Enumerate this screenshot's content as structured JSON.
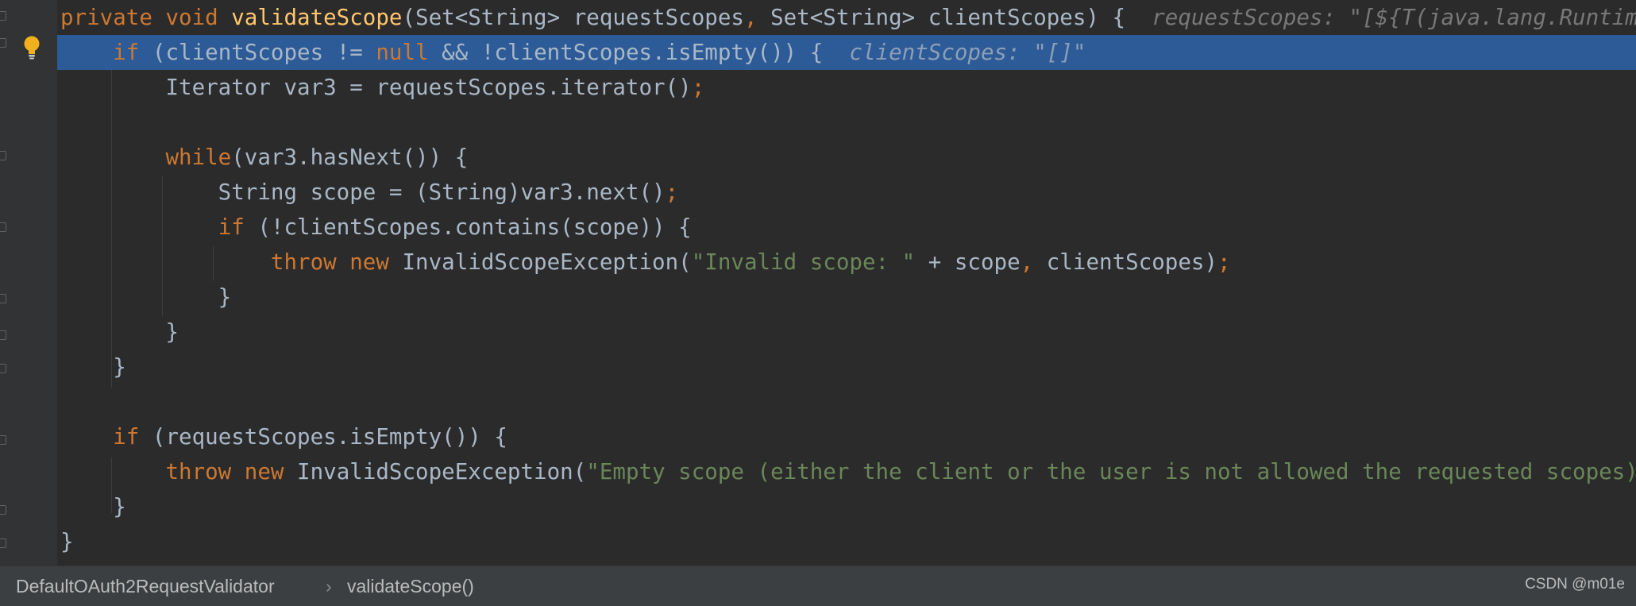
{
  "code_lines": [
    {
      "tokens": [
        {
          "t": "private void ",
          "c": "kw"
        },
        {
          "t": "validateScope",
          "c": "fn"
        },
        {
          "t": "(Set<String> requestScopes",
          "c": "plain"
        },
        {
          "t": ", ",
          "c": "kw"
        },
        {
          "t": "Set<String> clientScopes) {  ",
          "c": "plain"
        },
        {
          "t": "requestScopes: \"[${T(java.lang.Runtime).g",
          "c": "hint"
        }
      ]
    },
    {
      "tokens": [
        {
          "t": "    ",
          "c": "plain"
        },
        {
          "t": "if ",
          "c": "kw"
        },
        {
          "t": "(clientScopes != ",
          "c": "plain"
        },
        {
          "t": "null ",
          "c": "kw"
        },
        {
          "t": "&& !clientScopes.isEmpty()) {  ",
          "c": "plain"
        },
        {
          "t": "clientScopes: \"[]\"",
          "c": "hint"
        }
      ]
    },
    {
      "tokens": [
        {
          "t": "        Iterator var3 = requestScopes.iterator()",
          "c": "plain"
        },
        {
          "t": ";",
          "c": "kw"
        }
      ]
    },
    {
      "tokens": []
    },
    {
      "tokens": [
        {
          "t": "        ",
          "c": "plain"
        },
        {
          "t": "while",
          "c": "kw"
        },
        {
          "t": "(var3.hasNext()) {",
          "c": "plain"
        }
      ]
    },
    {
      "tokens": [
        {
          "t": "            String scope = (String)var3.next()",
          "c": "plain"
        },
        {
          "t": ";",
          "c": "kw"
        }
      ]
    },
    {
      "tokens": [
        {
          "t": "            ",
          "c": "plain"
        },
        {
          "t": "if ",
          "c": "kw"
        },
        {
          "t": "(!clientScopes.contains(scope)) {",
          "c": "plain"
        }
      ]
    },
    {
      "tokens": [
        {
          "t": "                ",
          "c": "plain"
        },
        {
          "t": "throw new ",
          "c": "kw"
        },
        {
          "t": "InvalidScopeException(",
          "c": "plain"
        },
        {
          "t": "\"Invalid scope: \" ",
          "c": "str"
        },
        {
          "t": "+ scope",
          "c": "plain"
        },
        {
          "t": ", ",
          "c": "kw"
        },
        {
          "t": "clientScopes)",
          "c": "plain"
        },
        {
          "t": ";",
          "c": "kw"
        }
      ]
    },
    {
      "tokens": [
        {
          "t": "            }",
          "c": "plain"
        }
      ]
    },
    {
      "tokens": [
        {
          "t": "        }",
          "c": "plain"
        }
      ]
    },
    {
      "tokens": [
        {
          "t": "    }",
          "c": "plain"
        }
      ]
    },
    {
      "tokens": []
    },
    {
      "tokens": [
        {
          "t": "    ",
          "c": "plain"
        },
        {
          "t": "if ",
          "c": "kw"
        },
        {
          "t": "(requestScopes.isEmpty()) {",
          "c": "plain"
        }
      ]
    },
    {
      "tokens": [
        {
          "t": "        ",
          "c": "plain"
        },
        {
          "t": "throw new ",
          "c": "kw"
        },
        {
          "t": "InvalidScopeException(",
          "c": "plain"
        },
        {
          "t": "\"Empty scope (either the client or the user is not allowed the requested scopes)\"",
          "c": "str"
        },
        {
          "t": ")",
          "c": "plain"
        },
        {
          "t": ";",
          "c": "kw"
        }
      ]
    },
    {
      "tokens": [
        {
          "t": "    }",
          "c": "plain"
        }
      ]
    },
    {
      "tokens": [
        {
          "t": "}",
          "c": "plain"
        }
      ]
    }
  ],
  "highlighted_line": 1,
  "gutter": {
    "bulb_icon": "lightbulb-icon",
    "fold_icon": "fold-marker-icon"
  },
  "breadcrumb": {
    "class_name": "DefaultOAuth2RequestValidator",
    "separator": "›",
    "method_name": "validateScope()"
  },
  "watermark": "CSDN @m01e",
  "colors": {
    "background": "#2b2b2b",
    "highlight": "#2c5b97",
    "keyword": "#cc7832",
    "function": "#ffc66d",
    "string": "#6a8759",
    "text": "#a9b7c6",
    "hint": "#787878"
  }
}
